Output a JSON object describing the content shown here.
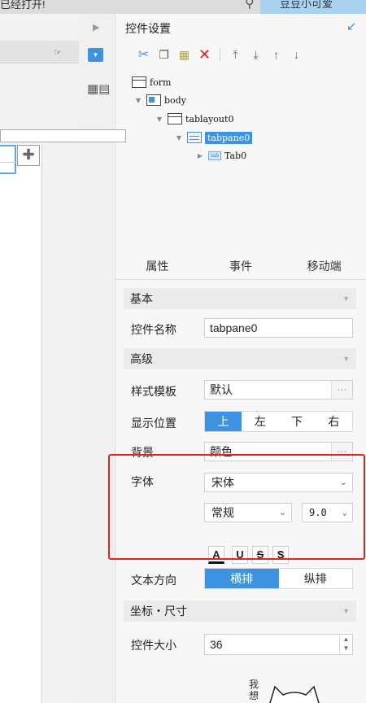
{
  "topbar": {
    "open_text": "已经打开!",
    "user_label": "豆豆小可爱"
  },
  "panel": {
    "title": "控件设置",
    "toolbar_icons": [
      "cut-icon",
      "copy-icon",
      "paste-icon",
      "delete-icon",
      "move-top-icon",
      "move-bottom-icon",
      "move-up-icon",
      "move-down-icon"
    ]
  },
  "tree": {
    "form": "form",
    "body": "body",
    "tablayout": "tablayout0",
    "tabpane": "tabpane0",
    "tab": "Tab0",
    "tab_icon_text": "tab"
  },
  "tabs": [
    "属性",
    "事件",
    "移动端"
  ],
  "sections": {
    "basic": "基本",
    "advanced": "高级",
    "coordinates": "坐标・尺寸"
  },
  "fields": {
    "widget_name_label": "控件名称",
    "widget_name_value": "tabpane0",
    "style_template_label": "样式模板",
    "style_template_value": "默认",
    "display_position_label": "显示位置",
    "position_options": [
      "上",
      "左",
      "下",
      "右"
    ],
    "position_selected": "上",
    "background_label": "背景",
    "background_value": "颜色",
    "font_label": "字体",
    "font_family": "宋体",
    "font_style": "常规",
    "font_size": "9.0",
    "font_buttons": [
      "A",
      "U",
      "S",
      "S"
    ],
    "text_direction_label": "文本方向",
    "text_direction_options": [
      "横排",
      "纵排"
    ],
    "text_direction_selected": "横排",
    "widget_size_label": "控件大小",
    "widget_size_value": "36"
  },
  "mascot": {
    "text": "我\n想"
  },
  "colors": {
    "accent": "#3d93e0",
    "highlight_border": "#e0261e"
  }
}
